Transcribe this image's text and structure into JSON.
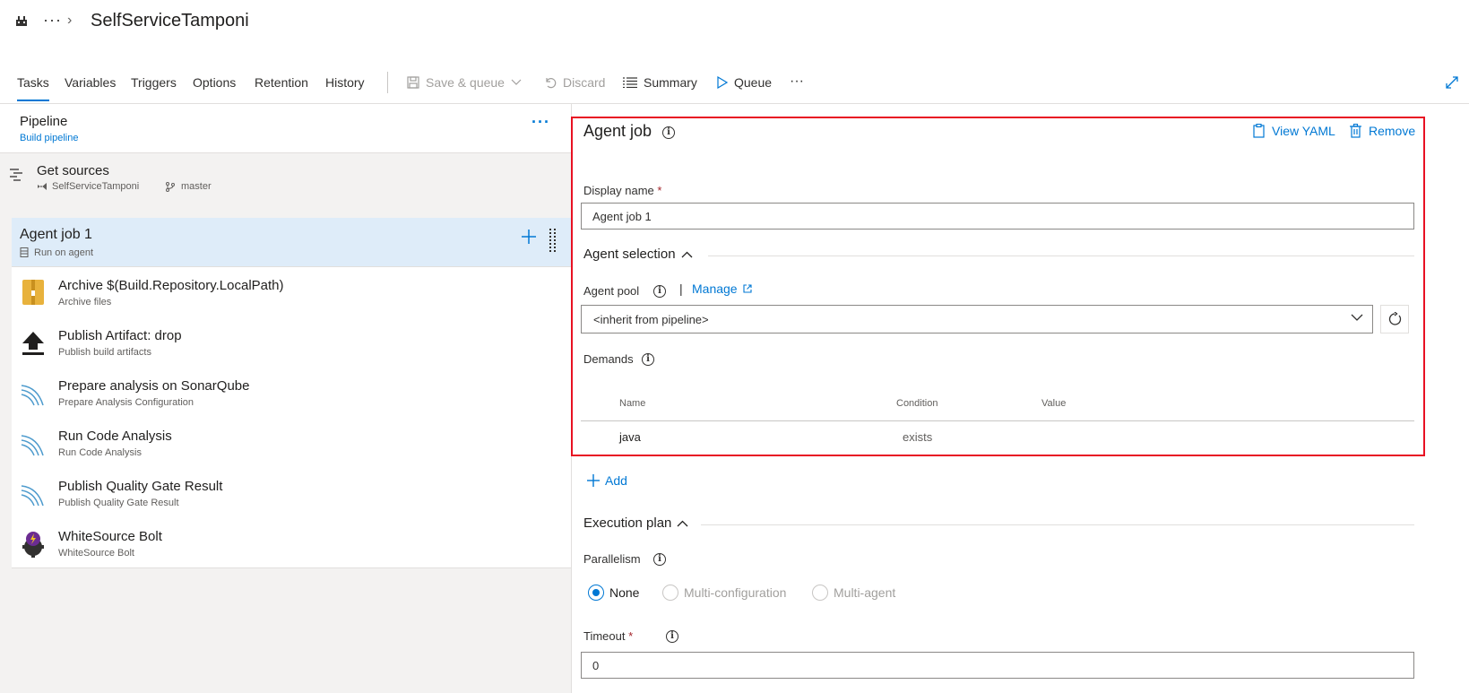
{
  "header": {
    "project_title": "SelfServiceTamponi",
    "more_label": "···",
    "chevron": "›"
  },
  "toolbar": {
    "tabs": [
      {
        "label": "Tasks",
        "active": true
      },
      {
        "label": "Variables",
        "active": false
      },
      {
        "label": "Triggers",
        "active": false
      },
      {
        "label": "Options",
        "active": false
      },
      {
        "label": "Retention",
        "active": false
      },
      {
        "label": "History",
        "active": false
      }
    ],
    "save_queue_label": "Save & queue",
    "discard_label": "Discard",
    "summary_label": "Summary",
    "queue_label": "Queue",
    "more_label": "···"
  },
  "pipeline": {
    "title": "Pipeline",
    "subtitle": "Build pipeline",
    "more_label": "···"
  },
  "get_sources": {
    "title": "Get sources",
    "repo": "SelfServiceTamponi",
    "branch": "master"
  },
  "job": {
    "title": "Agent job 1",
    "subtitle": "Run on agent"
  },
  "tasks": [
    {
      "name": "Archive $(Build.Repository.LocalPath)",
      "sub": "Archive files",
      "icon": "archive-zip-icon"
    },
    {
      "name": "Publish Artifact: drop",
      "sub": "Publish build artifacts",
      "icon": "upload-arrow-icon"
    },
    {
      "name": "Prepare analysis on SonarQube",
      "sub": "Prepare Analysis Configuration",
      "icon": "sonarqube-icon"
    },
    {
      "name": "Run Code Analysis",
      "sub": "Run Code Analysis",
      "icon": "sonarqube-icon"
    },
    {
      "name": "Publish Quality Gate Result",
      "sub": "Publish Quality Gate Result",
      "icon": "sonarqube-icon"
    },
    {
      "name": "WhiteSource Bolt",
      "sub": "WhiteSource Bolt",
      "icon": "whitesource-bolt-icon"
    }
  ],
  "detail": {
    "title": "Agent job",
    "view_yaml_label": "View YAML",
    "remove_label": "Remove",
    "display_name_label": "Display name",
    "required_mark": "*",
    "display_name_value": "Agent job 1",
    "agent_selection_label": "Agent selection",
    "agent_pool_label": "Agent pool",
    "pipe_separator": "|",
    "manage_label": "Manage",
    "agent_pool_value": "<inherit from pipeline>",
    "demands_label": "Demands",
    "demands_columns": [
      "Name",
      "Condition",
      "Value"
    ],
    "demands_rows": [
      {
        "name": "java",
        "condition": "exists",
        "value": ""
      }
    ],
    "add_label": "Add",
    "execution_plan_label": "Execution plan",
    "parallelism_label": "Parallelism",
    "parallelism_options": [
      {
        "label": "None",
        "checked": true
      },
      {
        "label": "Multi-configuration",
        "checked": false
      },
      {
        "label": "Multi-agent",
        "checked": false
      }
    ],
    "timeout_label": "Timeout",
    "timeout_value": "0"
  },
  "colors": {
    "accent": "#0078d4",
    "highlight_border": "#e81123",
    "selected_row": "#deecf9"
  }
}
